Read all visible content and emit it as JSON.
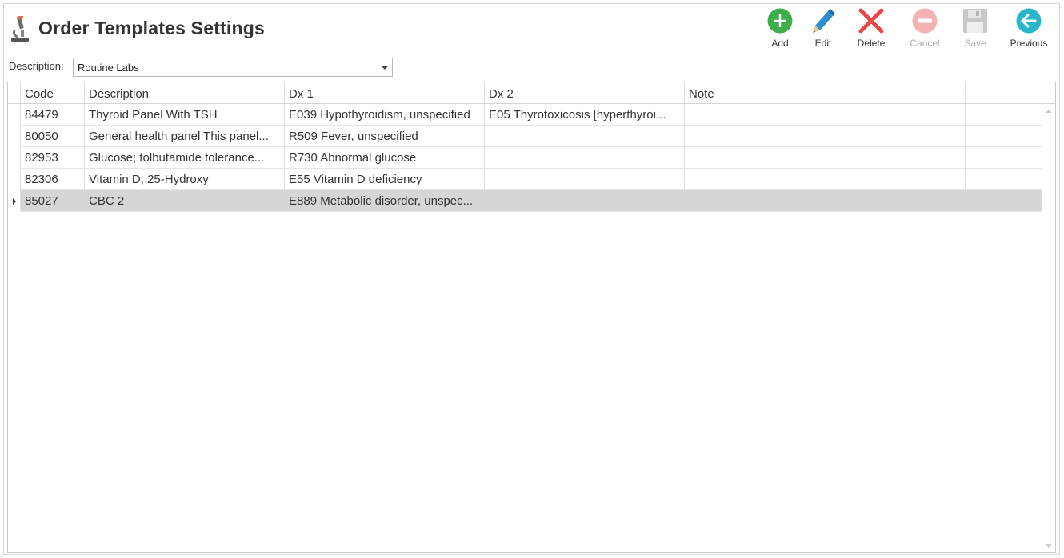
{
  "page": {
    "title": "Order Templates Settings",
    "title_icon": "microscope-icon"
  },
  "toolbar": {
    "add": {
      "label": "Add",
      "icon": "plus-circle-icon",
      "color": "#3dae4a"
    },
    "edit": {
      "label": "Edit",
      "icon": "pencil-icon",
      "color": "#2b8fd0"
    },
    "delete": {
      "label": "Delete",
      "icon": "x-icon",
      "color": "#e84848"
    },
    "cancel": {
      "label": "Cancel",
      "icon": "minus-circle-icon",
      "color": "#f3b3b3"
    },
    "save": {
      "label": "Save",
      "icon": "floppy-disk-icon",
      "color": "#c8c8c8"
    },
    "previous": {
      "label": "Previous",
      "icon": "arrow-left-circle-icon",
      "color": "#2bb5c8"
    }
  },
  "filter": {
    "label": "Description:",
    "selected": "Routine Labs"
  },
  "grid": {
    "columns": [
      "Code",
      "Description",
      "Dx 1",
      "Dx 2",
      "Note"
    ],
    "rows": [
      {
        "code": "84479",
        "description": "Thyroid Panel With TSH",
        "dx1": "E039 Hypothyroidism, unspecified",
        "dx2": "E05 Thyrotoxicosis [hyperthyroi...",
        "note": ""
      },
      {
        "code": "80050",
        "description": "General health panel This panel...",
        "dx1": "R509 Fever, unspecified",
        "dx2": "",
        "note": ""
      },
      {
        "code": "82953",
        "description": "Glucose; tolbutamide tolerance...",
        "dx1": "R730 Abnormal glucose",
        "dx2": "",
        "note": ""
      },
      {
        "code": "82306",
        "description": "Vitamin D, 25-Hydroxy",
        "dx1": "E55 Vitamin D deficiency",
        "dx2": "",
        "note": ""
      },
      {
        "code": "85027",
        "description": "CBC 2",
        "dx1": "E889 Metabolic disorder, unspec...",
        "dx2": "",
        "note": ""
      }
    ],
    "selected_row": 4
  }
}
